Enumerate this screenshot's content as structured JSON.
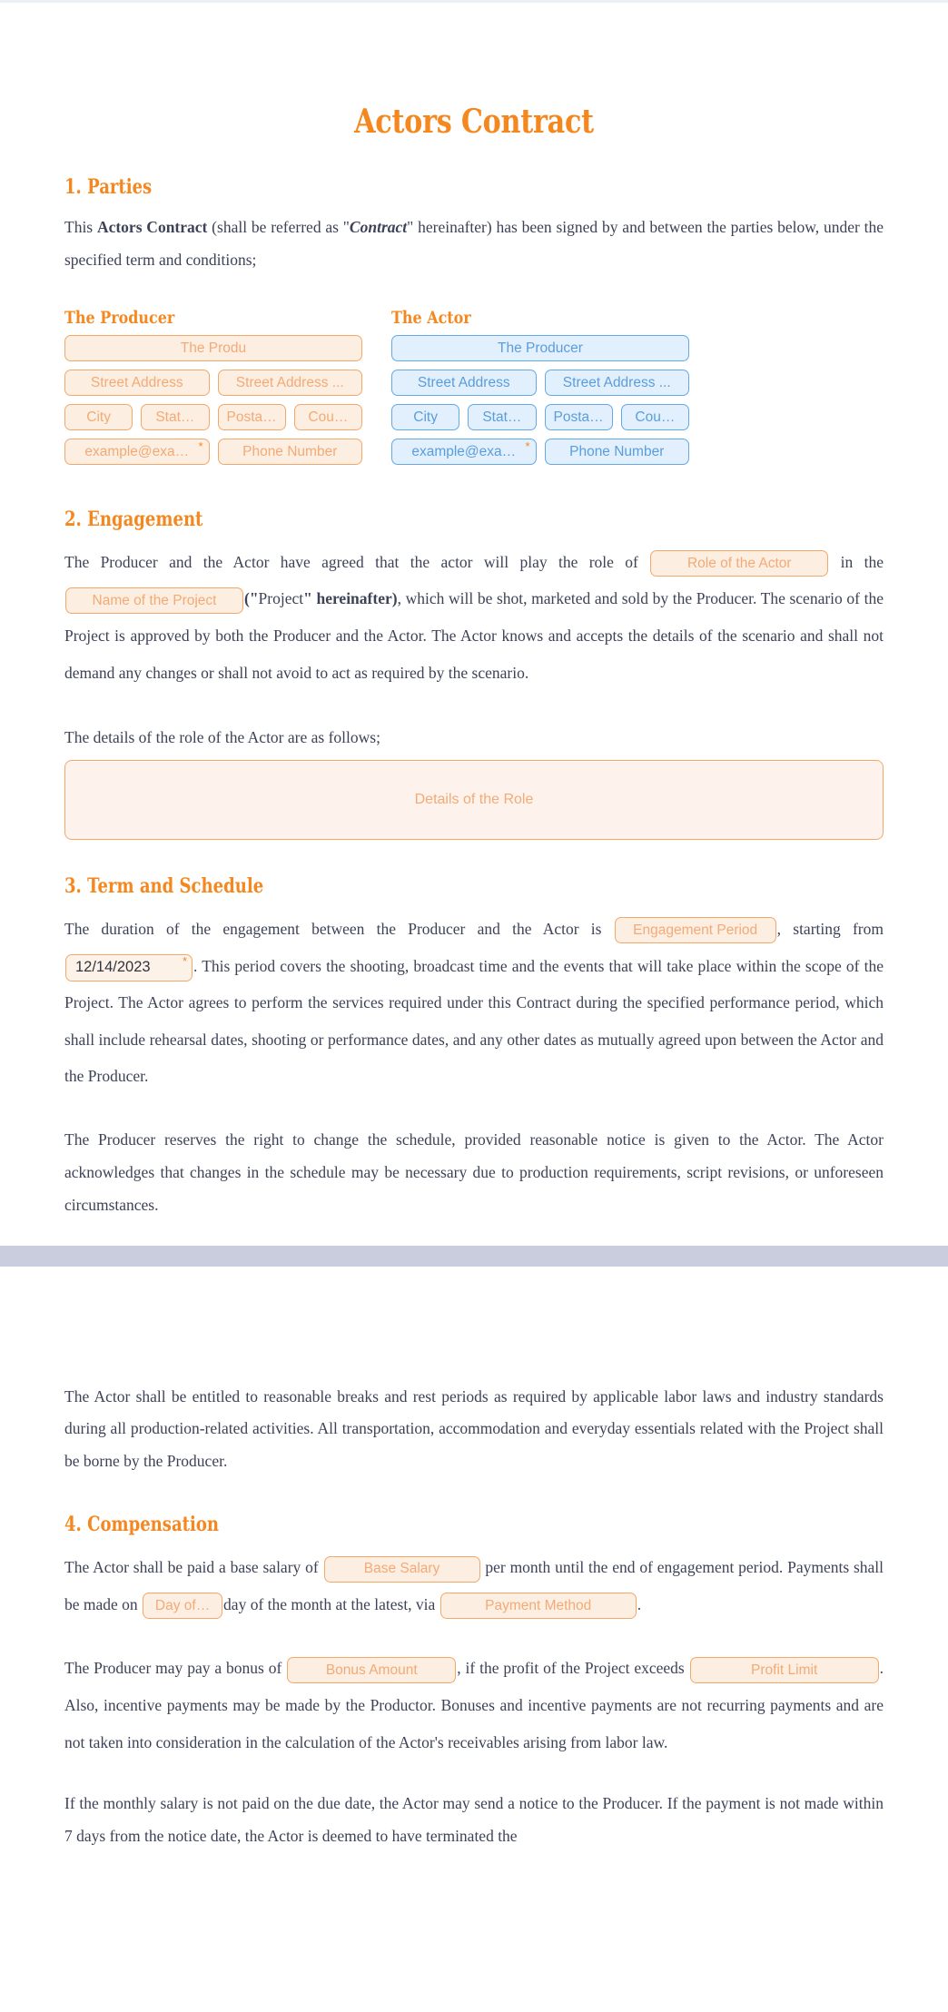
{
  "document": {
    "title": "Actors Contract"
  },
  "theme": {
    "accent_orange": "#f5871f",
    "field_orange_border": "#f3a86a",
    "field_orange_bg": "#fdeee2",
    "field_blue_border": "#62a9e8",
    "field_blue_bg": "#e2f0fd",
    "body_text": "#3d4257"
  },
  "sections": {
    "parties": {
      "heading": "1. Parties",
      "intro_1": "This ",
      "intro_strong": "Actors Contract",
      "intro_2": " (shall be referred as \"",
      "intro_bi": "Contract",
      "intro_3": "\" hereinafter) has been signed by and between the parties below, under the specified term and conditions;",
      "producer": {
        "heading": "The Producer",
        "name_field": "The Produ",
        "street_address_1": "Street Address",
        "street_address_2": "Street Address ...",
        "city": "City",
        "state": "Stat…",
        "postal": "Posta…",
        "country": "Cou…",
        "email": "example@exa…",
        "phone": "Phone Number",
        "required_mark": "*"
      },
      "actor": {
        "heading": "The Actor",
        "name_field": "The Producer",
        "street_address_1": "Street Address",
        "street_address_2": "Street Address ...",
        "city": "City",
        "state": "Stat…",
        "postal": "Posta…",
        "country": "Cou…",
        "email": "example@exa…",
        "phone": "Phone Number",
        "required_mark": "*"
      }
    },
    "engagement": {
      "heading": "2. Engagement",
      "text_1": "The Producer and the Actor have agreed that the actor will play the role of",
      "field_role": "Role of the Actor",
      "text_2": "in the",
      "field_project": "Name of the Project",
      "text_3_quote_open": "(\"",
      "text_3_bi": "Project",
      "text_3_quote_close": "\" hereinafter)",
      "text_4": ", which will be shot, marketed and sold by the Producer. The scenario of the Project is approved by both the Producer and the Actor. The Actor knows and accepts the details of the scenario and shall not demand any changes or shall not avoid to act as required by the scenario.",
      "details_label": "The details of the role of the Actor are as follows;",
      "details_placeholder": "Details of the Role"
    },
    "term": {
      "heading": "3. Term and Schedule",
      "text_1": "The duration of the engagement between the Producer and the Actor is",
      "field_period": "Engagement Period",
      "text_2": ", starting from",
      "field_date": "12/14/2023",
      "required_mark": "*",
      "text_3": ". This period covers the shooting, broadcast time and the events that will take place within the scope of the Project. The Actor agrees to perform the services required under this Contract during the specified performance period, which shall include rehearsal dates, shooting or performance dates, and any other dates as mutually agreed upon between the Actor and the Producer.",
      "paragraph_2": "The Producer reserves the right to change the schedule, provided reasonable notice is given to the Actor. The Actor acknowledges that changes in the schedule may be necessary due to production requirements, script revisions, or unforeseen circumstances."
    },
    "page2": {
      "breaks_paragraph": "The Actor shall be entitled to reasonable breaks and rest periods as required by applicable labor laws and industry standards during all production-related activities. All transportation, accommodation and everyday essentials related with the Project shall be borne by the Producer."
    },
    "compensation": {
      "heading": "4. Compensation",
      "text_1": "The Actor shall be paid a base salary of",
      "field_base_salary": "Base Salary",
      "text_2": "per month until the end of engagement period. Payments shall be made on",
      "field_day_of": "Day of…",
      "text_3": "day of the month at the latest, via",
      "field_payment_method": "Payment Method",
      "text_4": ".",
      "bonus_text_1": "The Producer may pay a bonus of",
      "field_bonus_amount": "Bonus Amount",
      "bonus_text_2": ", if the profit of the Project exceeds",
      "field_profit_limit": "Profit Limit",
      "bonus_text_3": ". Also, incentive payments may be made by the Productor. Bonuses and incentive payments are not recurring payments and are not taken into consideration in the calculation of the Actor's receivables arising from labor law.",
      "late_text": "If the monthly salary is not paid on the due date, the Actor may send a notice to the Producer. If the payment is not made within 7 days from the notice date, the Actor is deemed to have terminated the"
    }
  }
}
